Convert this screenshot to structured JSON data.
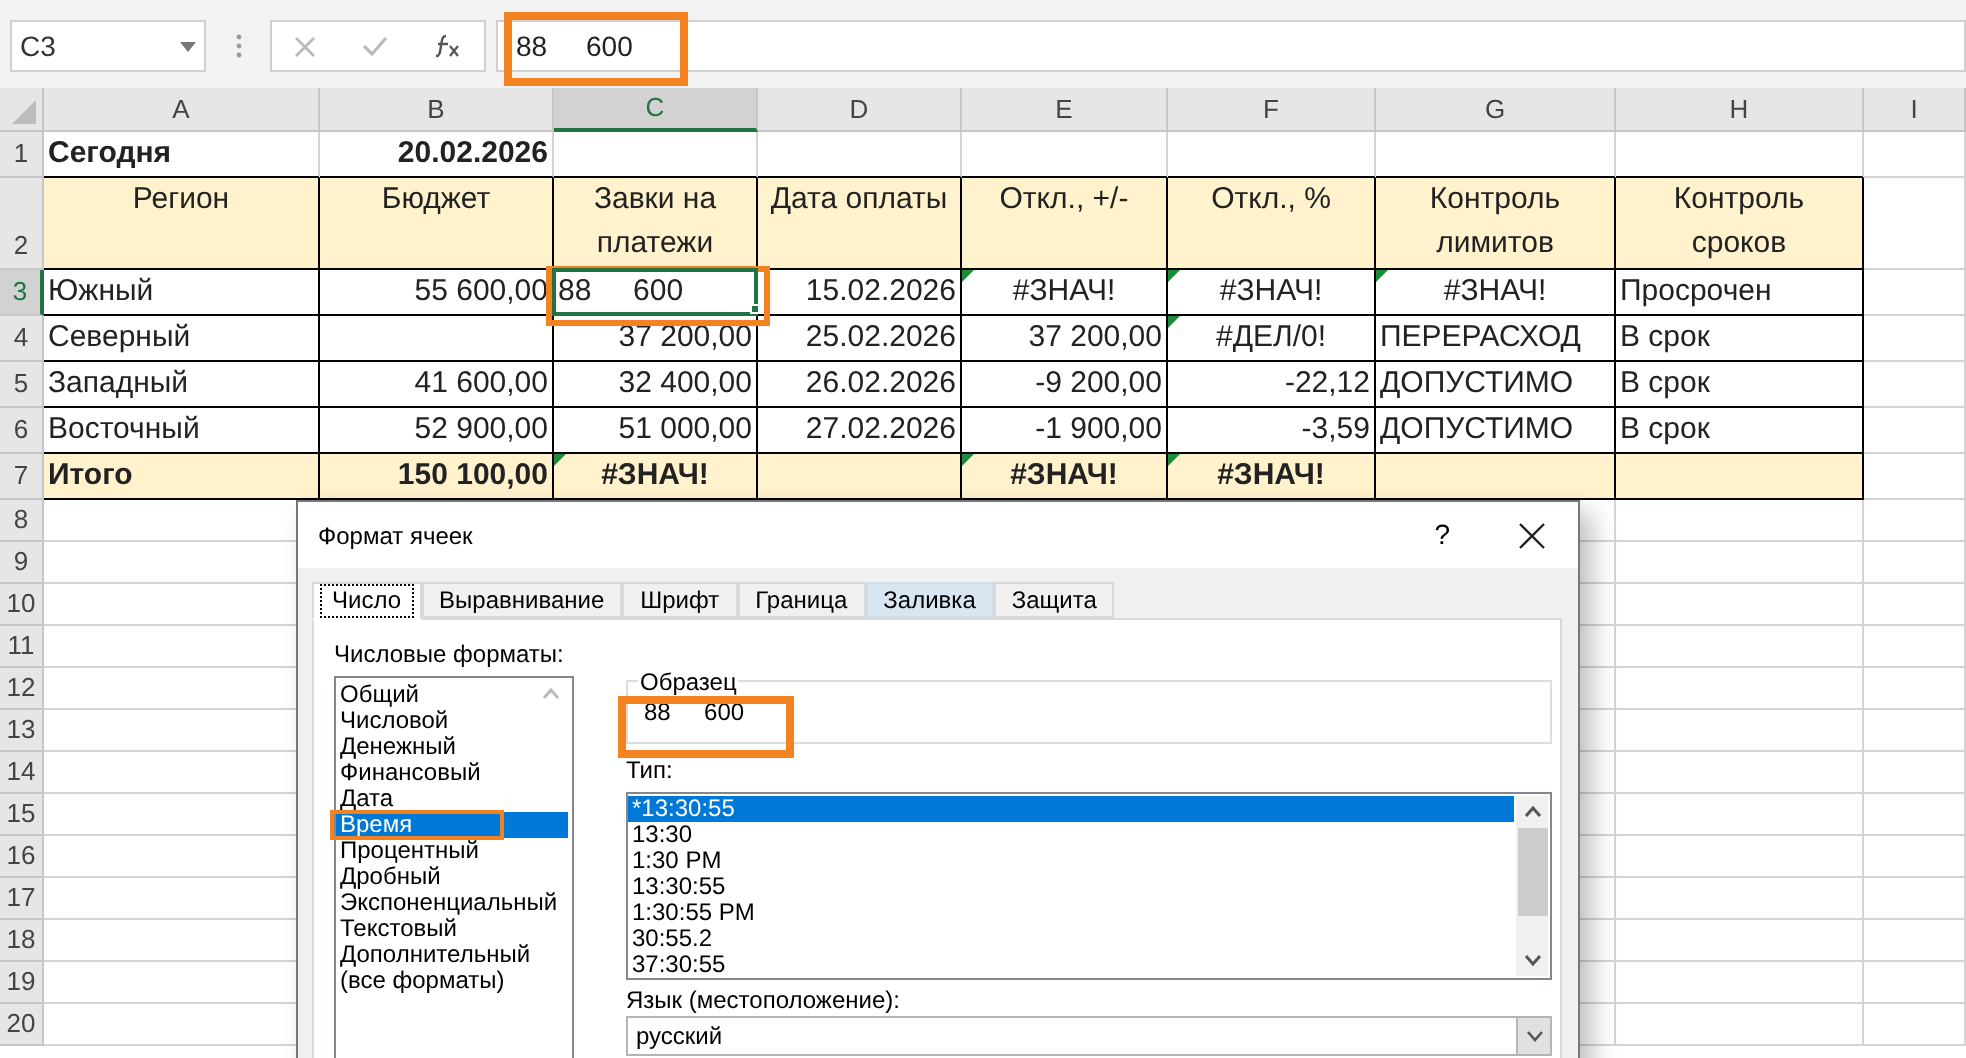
{
  "formula_bar": {
    "name_box": "C3",
    "value": "88     600"
  },
  "columns": [
    {
      "label": "A",
      "selected": false
    },
    {
      "label": "B",
      "selected": false
    },
    {
      "label": "C",
      "selected": true
    },
    {
      "label": "D",
      "selected": false
    },
    {
      "label": "E",
      "selected": false
    },
    {
      "label": "F",
      "selected": false
    },
    {
      "label": "G",
      "selected": false
    },
    {
      "label": "H",
      "selected": false
    },
    {
      "label": "I",
      "selected": false
    }
  ],
  "rows": [
    {
      "label": "1",
      "selected": false,
      "kind": "title",
      "cells": [
        {
          "text": "Сегодня",
          "kind": "text",
          "error_mark": false
        },
        {
          "text": "20.02.2026",
          "kind": "number",
          "error_mark": false
        }
      ]
    },
    {
      "label": "2",
      "selected": false,
      "kind": "header",
      "cells": [
        {
          "text": "Регион",
          "error_mark": false
        },
        {
          "text": "Бюджет",
          "error_mark": false
        },
        {
          "text": "Завки на платежи",
          "error_mark": false
        },
        {
          "text": "Дата оплаты",
          "error_mark": false
        },
        {
          "text": "Откл., +/-",
          "error_mark": false
        },
        {
          "text": "Откл., %",
          "error_mark": false
        },
        {
          "text": "Контроль лимитов",
          "error_mark": false
        },
        {
          "text": "Контроль сроков",
          "error_mark": false
        }
      ]
    },
    {
      "label": "3",
      "selected": true,
      "kind": "data",
      "cells": [
        {
          "text": "Южный",
          "kind": "text",
          "error_mark": false
        },
        {
          "text": "55 600,00",
          "kind": "number",
          "error_mark": false
        },
        {
          "text": "88     600",
          "kind": "text",
          "error_mark": false
        },
        {
          "text": "15.02.2026",
          "kind": "number",
          "error_mark": false
        },
        {
          "text": "#ЗНАЧ!",
          "kind": "error",
          "error_mark": true
        },
        {
          "text": "#ЗНАЧ!",
          "kind": "error",
          "error_mark": true
        },
        {
          "text": "#ЗНАЧ!",
          "kind": "error",
          "error_mark": true
        },
        {
          "text": "Просрочен",
          "kind": "text",
          "error_mark": false
        }
      ]
    },
    {
      "label": "4",
      "selected": false,
      "kind": "data",
      "cells": [
        {
          "text": "Северный",
          "kind": "text",
          "error_mark": false
        },
        null,
        {
          "text": "37 200,00",
          "kind": "number",
          "error_mark": false
        },
        {
          "text": "25.02.2026",
          "kind": "number",
          "error_mark": false
        },
        {
          "text": "37 200,00",
          "kind": "number",
          "error_mark": false
        },
        {
          "text": "#ДЕЛ/0!",
          "kind": "error",
          "error_mark": true
        },
        {
          "text": "ПЕРЕРАСХОД",
          "kind": "text",
          "error_mark": false
        },
        {
          "text": "В срок",
          "kind": "text",
          "error_mark": false
        }
      ]
    },
    {
      "label": "5",
      "selected": false,
      "kind": "data",
      "cells": [
        {
          "text": "Западный",
          "kind": "text",
          "error_mark": false
        },
        {
          "text": "41 600,00",
          "kind": "number",
          "error_mark": false
        },
        {
          "text": "32 400,00",
          "kind": "number",
          "error_mark": false
        },
        {
          "text": "26.02.2026",
          "kind": "number",
          "error_mark": false
        },
        {
          "text": "-9 200,00",
          "kind": "number",
          "error_mark": false
        },
        {
          "text": "-22,12",
          "kind": "number",
          "error_mark": false
        },
        {
          "text": "ДОПУСТИМО",
          "kind": "text",
          "error_mark": false
        },
        {
          "text": "В срок",
          "kind": "text",
          "error_mark": false
        }
      ]
    },
    {
      "label": "6",
      "selected": false,
      "kind": "data",
      "cells": [
        {
          "text": "Восточный",
          "kind": "text",
          "error_mark": false
        },
        {
          "text": "52 900,00",
          "kind": "number",
          "error_mark": false
        },
        {
          "text": "51 000,00",
          "kind": "number",
          "error_mark": false
        },
        {
          "text": "27.02.2026",
          "kind": "number",
          "error_mark": false
        },
        {
          "text": "-1 900,00",
          "kind": "number",
          "error_mark": false
        },
        {
          "text": "-3,59",
          "kind": "number",
          "error_mark": false
        },
        {
          "text": "ДОПУСТИМО",
          "kind": "text",
          "error_mark": false
        },
        {
          "text": "В срок",
          "kind": "text",
          "error_mark": false
        }
      ]
    },
    {
      "label": "7",
      "selected": false,
      "kind": "total",
      "cells": [
        {
          "text": "Итого",
          "kind": "text",
          "error_mark": false
        },
        {
          "text": "150 100,00",
          "kind": "number",
          "error_mark": false
        },
        {
          "text": "#ЗНАЧ!",
          "kind": "error",
          "error_mark": true
        },
        null,
        {
          "text": "#ЗНАЧ!",
          "kind": "error",
          "error_mark": true
        },
        {
          "text": "#ЗНАЧ!",
          "kind": "error",
          "error_mark": true
        },
        null,
        null
      ]
    },
    {
      "label": "8",
      "selected": false,
      "kind": "empty",
      "cells": []
    },
    {
      "label": "9",
      "selected": false,
      "kind": "empty",
      "cells": []
    },
    {
      "label": "10",
      "selected": false,
      "kind": "empty",
      "cells": []
    },
    {
      "label": "11",
      "selected": false,
      "kind": "empty",
      "cells": []
    },
    {
      "label": "12",
      "selected": false,
      "kind": "empty",
      "cells": []
    },
    {
      "label": "13",
      "selected": false,
      "kind": "empty",
      "cells": []
    },
    {
      "label": "14",
      "selected": false,
      "kind": "empty",
      "cells": []
    },
    {
      "label": "15",
      "selected": false,
      "kind": "empty",
      "cells": []
    },
    {
      "label": "16",
      "selected": false,
      "kind": "empty",
      "cells": []
    },
    {
      "label": "17",
      "selected": false,
      "kind": "empty",
      "cells": []
    },
    {
      "label": "18",
      "selected": false,
      "kind": "empty",
      "cells": []
    },
    {
      "label": "19",
      "selected": false,
      "kind": "empty",
      "cells": []
    },
    {
      "label": "20",
      "selected": false,
      "kind": "empty",
      "cells": []
    }
  ],
  "dialog": {
    "title": "Формат ячеек",
    "help": "?",
    "tabs": [
      {
        "label": "Число",
        "selected": true,
        "hovered": false
      },
      {
        "label": "Выравнивание",
        "selected": false,
        "hovered": false
      },
      {
        "label": "Шрифт",
        "selected": false,
        "hovered": false
      },
      {
        "label": "Граница",
        "selected": false,
        "hovered": false
      },
      {
        "label": "Заливка",
        "selected": false,
        "hovered": true
      },
      {
        "label": "Защита",
        "selected": false,
        "hovered": false
      }
    ],
    "formats_label": "Числовые форматы:",
    "formats": [
      {
        "label": "Общий",
        "selected": false
      },
      {
        "label": "Числовой",
        "selected": false
      },
      {
        "label": "Денежный",
        "selected": false
      },
      {
        "label": "Финансовый",
        "selected": false
      },
      {
        "label": "Дата",
        "selected": false
      },
      {
        "label": "Время",
        "selected": true
      },
      {
        "label": "Процентный",
        "selected": false
      },
      {
        "label": "Дробный",
        "selected": false
      },
      {
        "label": "Экспоненциальный",
        "selected": false
      },
      {
        "label": "Текстовый",
        "selected": false
      },
      {
        "label": "Дополнительный",
        "selected": false
      },
      {
        "label": "(все форматы)",
        "selected": false
      }
    ],
    "sample_label": "Образец",
    "sample": "88     600",
    "type_label": "Тип:",
    "types": [
      {
        "label": "*13:30:55",
        "selected": true
      },
      {
        "label": "13:30",
        "selected": false
      },
      {
        "label": "1:30 PM",
        "selected": false
      },
      {
        "label": "13:30:55",
        "selected": false
      },
      {
        "label": "1:30:55 PM",
        "selected": false
      },
      {
        "label": "30:55.2",
        "selected": false
      },
      {
        "label": "37:30:55",
        "selected": false
      }
    ],
    "language_label": "Язык (местоположение):",
    "language": "русский"
  }
}
